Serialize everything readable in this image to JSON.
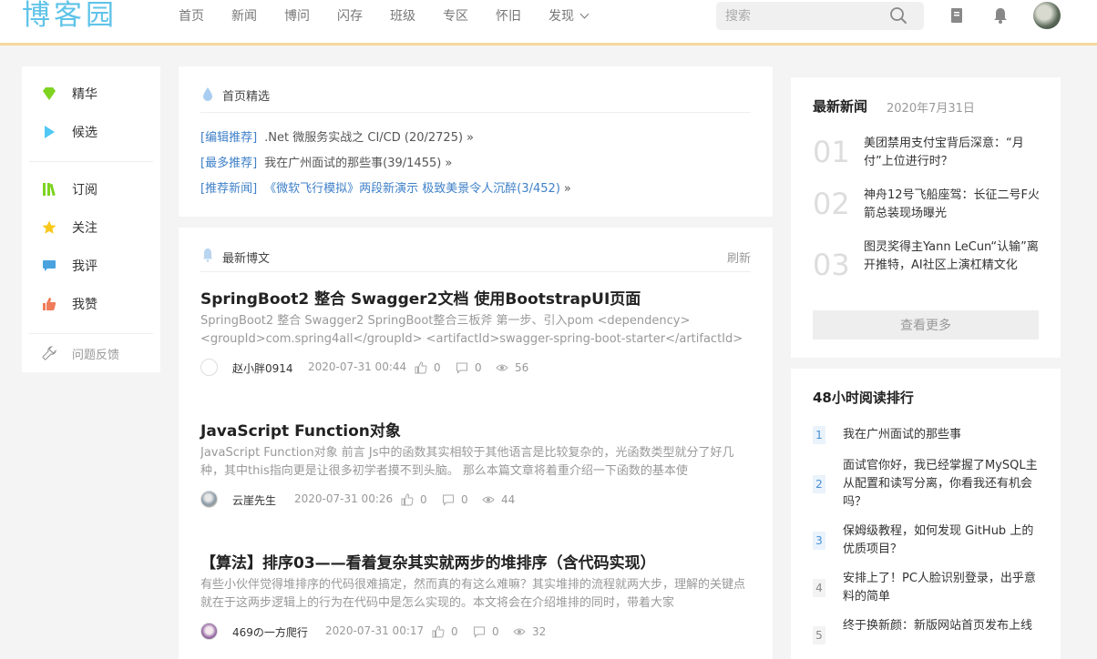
{
  "header": {
    "logo": "博客园",
    "nav": [
      "首页",
      "新闻",
      "博问",
      "闪存",
      "班级",
      "专区",
      "怀旧",
      "发现"
    ],
    "search_placeholder": "搜索"
  },
  "sidebar": {
    "items": [
      {
        "label": "精华",
        "icon": "diamond-icon",
        "color": "#7ed321"
      },
      {
        "label": "候选",
        "icon": "play-icon",
        "color": "#50c8f5"
      },
      {
        "label": "订阅",
        "icon": "books-icon",
        "color": "#7ed321"
      },
      {
        "label": "关注",
        "icon": "star-icon",
        "color": "#f8c81c"
      },
      {
        "label": "我评",
        "icon": "comment-icon",
        "color": "#4aa3df"
      },
      {
        "label": "我赞",
        "icon": "thumbs-up-icon",
        "color": "#f07c5a"
      }
    ],
    "feedback": "问题反馈"
  },
  "featured": {
    "title": "首页精选",
    "rows": [
      {
        "tag": "[编辑推荐]",
        "text": ".Net 微服务实战之 CI/CD (20/2725)",
        "blue": false
      },
      {
        "tag": "[最多推荐]",
        "text": "我在广州面试的那些事(39/1455)",
        "blue": false
      },
      {
        "tag": "[推荐新闻]",
        "text": "《微软飞行模拟》两段新演示 极致美景令人沉醉(3/452)",
        "blue": true
      }
    ],
    "raquo": "»"
  },
  "posts": {
    "title": "最新博文",
    "refresh": "刷新",
    "items": [
      {
        "title": "SpringBoot2 整合 Swagger2文档 使用BootstrapUI页面",
        "summary": "SpringBoot2 整合 Swagger2 SpringBoot整合三板斧 第一步、引入pom <dependency> <groupId>com.spring4all</groupId> <artifactId>swagger-spring-boot-starter</artifactId> ...",
        "author": "赵小胖0914",
        "date": "2020-07-31 00:44",
        "likes": "0",
        "comments": "0",
        "views": "56"
      },
      {
        "title": "JavaScript Function对象",
        "summary": "JavaScript Function对象 前言 Js中的函数其实相较于其他语言是比较复杂的，光函数类型就分了好几种，其中this指向更是让很多初学者摸不到头脑。 那么本篇文章将着重介绍一下函数的基本使",
        "author": "云崖先生",
        "date": "2020-07-31 00:26",
        "likes": "0",
        "comments": "0",
        "views": "44"
      },
      {
        "title": "【算法】排序03——看着复杂其实就两步的堆排序（含代码实现）",
        "summary": "有些小伙伴觉得堆排序的代码很难搞定，然而真的有这么难嘛？其实堆排的流程就两大步，理解的关键点就在于这两步逻辑上的行为在代码中是怎么实现的。本文将会在介绍堆排的同时，带着大家",
        "author": "469の一方爬行",
        "date": "2020-07-31 00:17",
        "likes": "0",
        "comments": "0",
        "views": "32"
      }
    ]
  },
  "news": {
    "title": "最新新闻",
    "date": "2020年7月31日",
    "items": [
      {
        "num": "01",
        "text": "美团禁用支付宝背后深意：“月付”上位进行时？"
      },
      {
        "num": "02",
        "text": "神舟12号飞船座驾：长征二号F火箭总装现场曝光"
      },
      {
        "num": "03",
        "text": "图灵奖得主Yann LeCun“认输”离开推特，AI社区上演杠精文化"
      }
    ],
    "more": "查看更多"
  },
  "ranking": {
    "title": "48小时阅读排行",
    "items": [
      {
        "num": "1",
        "text": "我在广州面试的那些事"
      },
      {
        "num": "2",
        "text": "面试官你好，我已经掌握了MySQL主从配置和读写分离，你看我还有机会吗？"
      },
      {
        "num": "3",
        "text": "保姆级教程，如何发现 GitHub 上的优质项目？"
      },
      {
        "num": "4",
        "text": "安排上了！PC人脸识别登录，出乎意料的简单"
      },
      {
        "num": "5",
        "text": "终于换新颜：新版网站首页发布上线"
      }
    ]
  }
}
